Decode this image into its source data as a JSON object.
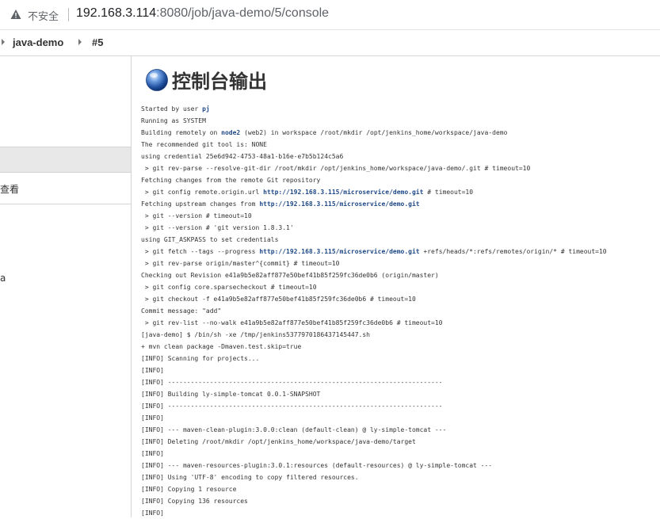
{
  "browser": {
    "security_label": "不安全",
    "url_host": "192.168.3.114",
    "url_path": ":8080/job/java-demo/5/console"
  },
  "breadcrumb": {
    "items": [
      {
        "label": "java-demo"
      },
      {
        "label": "#5"
      }
    ]
  },
  "sidebar": {
    "items": [
      {
        "label": ""
      },
      {
        "label": "查看"
      },
      {
        "label": "​"
      },
      {
        "label": "a"
      }
    ]
  },
  "page": {
    "title": "控制台输出"
  },
  "console": {
    "lines": [
      [
        {
          "t": "Started by user "
        },
        {
          "t": "pj",
          "link": true
        }
      ],
      [
        {
          "t": "Running as SYSTEM"
        }
      ],
      [
        {
          "t": "Building remotely on "
        },
        {
          "t": "node2",
          "link": true
        },
        {
          "t": " (web2) in workspace /root/mkdir /opt/jenkins_home/workspace/java-demo"
        }
      ],
      [
        {
          "t": "The recommended git tool is: NONE"
        }
      ],
      [
        {
          "t": "using credential 25e6d942-4753-48a1-b16e-e7b5b124c5a6"
        }
      ],
      [
        {
          "t": " > git rev-parse --resolve-git-dir /root/mkdir /opt/jenkins_home/workspace/java-demo/.git # timeout=10"
        }
      ],
      [
        {
          "t": "Fetching changes from the remote Git repository"
        }
      ],
      [
        {
          "t": " > git config remote.origin.url "
        },
        {
          "t": "http://192.168.3.115/microservice/demo.git",
          "link": true
        },
        {
          "t": " # timeout=10"
        }
      ],
      [
        {
          "t": "Fetching upstream changes from "
        },
        {
          "t": "http://192.168.3.115/microservice/demo.git",
          "link": true
        }
      ],
      [
        {
          "t": " > git --version # timeout=10"
        }
      ],
      [
        {
          "t": " > git --version # 'git version 1.8.3.1'"
        }
      ],
      [
        {
          "t": "using GIT_ASKPASS to set credentials"
        }
      ],
      [
        {
          "t": " > git fetch --tags --progress "
        },
        {
          "t": "http://192.168.3.115/microservice/demo.git",
          "link": true
        },
        {
          "t": " +refs/heads/*:refs/remotes/origin/* # timeout=10"
        }
      ],
      [
        {
          "t": " > git rev-parse origin/master^{commit} # timeout=10"
        }
      ],
      [
        {
          "t": "Checking out Revision e41a9b5e82aff877e50bef41b85f259fc36de0b6 (origin/master)"
        }
      ],
      [
        {
          "t": " > git config core.sparsecheckout # timeout=10"
        }
      ],
      [
        {
          "t": " > git checkout -f e41a9b5e82aff877e50bef41b85f259fc36de0b6 # timeout=10"
        }
      ],
      [
        {
          "t": "Commit message: \"add\""
        }
      ],
      [
        {
          "t": " > git rev-list --no-walk e41a9b5e82aff877e50bef41b85f259fc36de0b6 # timeout=10"
        }
      ],
      [
        {
          "t": "[java-demo] $ /bin/sh -xe /tmp/jenkins5377970186437145447.sh"
        }
      ],
      [
        {
          "t": "+ mvn clean package -Dmaven.test.skip=true"
        }
      ],
      [
        {
          "t": "[INFO] Scanning for projects..."
        }
      ],
      [
        {
          "t": "[INFO]"
        }
      ],
      [
        {
          "t": "[INFO] ------------------------------------------------------------------------"
        }
      ],
      [
        {
          "t": "[INFO] Building ly-simple-tomcat 0.0.1-SNAPSHOT"
        }
      ],
      [
        {
          "t": "[INFO] ------------------------------------------------------------------------"
        }
      ],
      [
        {
          "t": "[INFO]"
        }
      ],
      [
        {
          "t": "[INFO] --- maven-clean-plugin:3.0.0:clean (default-clean) @ ly-simple-tomcat ---"
        }
      ],
      [
        {
          "t": "[INFO] Deleting /root/mkdir /opt/jenkins_home/workspace/java-demo/target"
        }
      ],
      [
        {
          "t": "[INFO]"
        }
      ],
      [
        {
          "t": "[INFO] --- maven-resources-plugin:3.0.1:resources (default-resources) @ ly-simple-tomcat ---"
        }
      ],
      [
        {
          "t": "[INFO] Using 'UTF-8' encoding to copy filtered resources."
        }
      ],
      [
        {
          "t": "[INFO] Copying 1 resource"
        }
      ],
      [
        {
          "t": "[INFO] Copying 136 resources"
        }
      ],
      [
        {
          "t": "[INFO]"
        }
      ]
    ]
  },
  "colors": {
    "link": "#204a87",
    "side_active_bg": "#e8e8e8",
    "warning": "#5f6368"
  }
}
